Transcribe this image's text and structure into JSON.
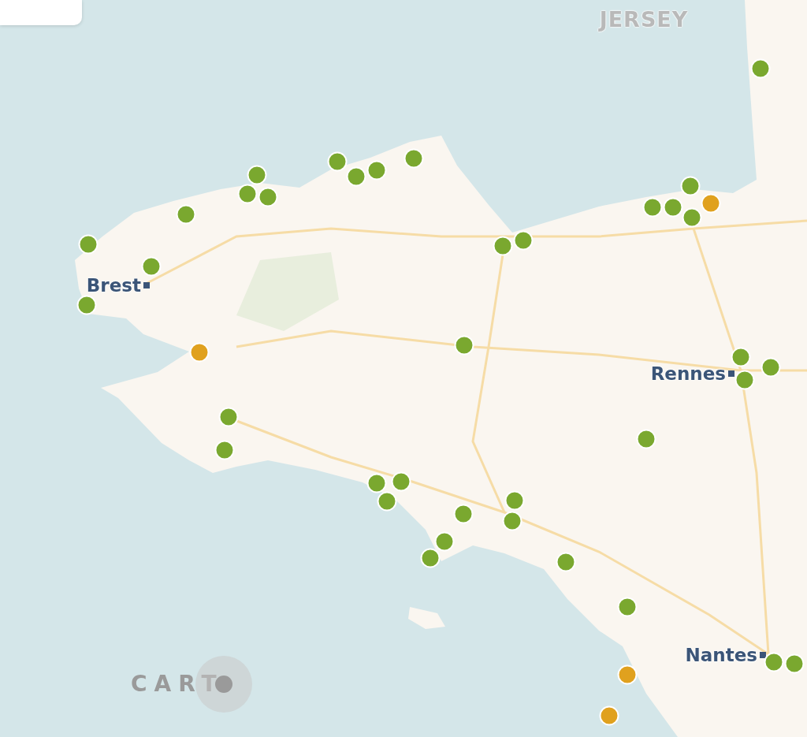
{
  "labels": [
    {
      "kind": "region",
      "name": "JERSEY"
    },
    {
      "kind": "city",
      "name": "Brest"
    },
    {
      "kind": "city",
      "name": "Rennes"
    },
    {
      "kind": "city",
      "name": "Nantes"
    }
  ],
  "markers": [
    {
      "color": "#7aa82f"
    },
    {
      "color": "#7aa82f"
    },
    {
      "color": "#7aa82f"
    },
    {
      "color": "#7aa82f"
    },
    {
      "color": "#7aa82f"
    },
    {
      "color": "#7aa82f"
    },
    {
      "color": "#7aa82f"
    },
    {
      "color": "#7aa82f"
    },
    {
      "color": "#7aa82f"
    },
    {
      "color": "#7aa82f"
    },
    {
      "color": "#7aa82f"
    },
    {
      "color": "#7aa82f"
    },
    {
      "color": "#e0a11e"
    },
    {
      "color": "#7aa82f"
    },
    {
      "color": "#7aa82f"
    },
    {
      "color": "#7aa82f"
    },
    {
      "color": "#7aa82f"
    },
    {
      "color": "#7aa82f"
    },
    {
      "color": "#e0a11e"
    },
    {
      "color": "#7aa82f"
    },
    {
      "color": "#7aa82f"
    },
    {
      "color": "#7aa82f"
    },
    {
      "color": "#7aa82f"
    },
    {
      "color": "#7aa82f"
    },
    {
      "color": "#7aa82f"
    },
    {
      "color": "#7aa82f"
    },
    {
      "color": "#7aa82f"
    },
    {
      "color": "#7aa82f"
    },
    {
      "color": "#7aa82f"
    },
    {
      "color": "#7aa82f"
    },
    {
      "color": "#7aa82f"
    },
    {
      "color": "#7aa82f"
    },
    {
      "color": "#7aa82f"
    },
    {
      "color": "#7aa82f"
    },
    {
      "color": "#7aa82f"
    },
    {
      "color": "#7aa82f"
    },
    {
      "color": "#7aa82f"
    },
    {
      "color": "#7aa82f"
    },
    {
      "color": "#7aa82f"
    },
    {
      "color": "#e0a11e"
    },
    {
      "color": "#e0a11e"
    }
  ],
  "attribution": {
    "logo_text": "CART"
  }
}
